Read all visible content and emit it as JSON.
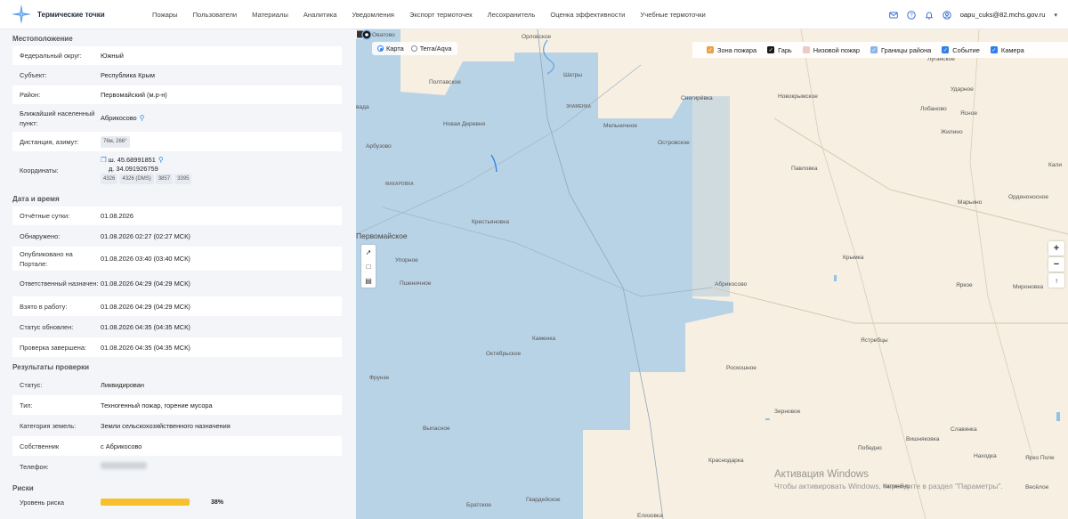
{
  "header": {
    "app_title": "Термические точки",
    "nav": [
      "Пожары",
      "Пользователи",
      "Материалы",
      "Аналитика",
      "Уведомления",
      "Экспорт термоточек",
      "Лесохранитель",
      "Оценка эффективности",
      "Учебные термоточки"
    ],
    "user_email": "oapu_cuks@82.mchs.gov.ru"
  },
  "location": {
    "title": "Местоположение",
    "rows": [
      {
        "label": "Федеральный округ:",
        "value": "Южный"
      },
      {
        "label": "Субъект:",
        "value": "Республика Крым"
      },
      {
        "label": "Район:",
        "value": "Первомайский (м.р-н)"
      },
      {
        "label": "Ближайший населенный пункт:",
        "value": "Абрикосово"
      },
      {
        "label": "Дистанция, азимут:",
        "value": "76м, 266°"
      },
      {
        "label": "Координаты:",
        "lat": "ш. 45.68991851",
        "lon": "д. 34.091926759",
        "chips": [
          "4326",
          "4326 (DMS)",
          "3857",
          "3395"
        ]
      }
    ]
  },
  "datetime": {
    "title": "Дата и время",
    "rows": [
      {
        "label": "Отчётные сутки:",
        "value": "01.08.2026"
      },
      {
        "label": "Обнаружено:",
        "value": "01.08.2026 02:27 (02:27 МСК)"
      },
      {
        "label": "Опубликовано на Портале:",
        "value": "01.08.2026 03:40 (03:40 МСК)"
      },
      {
        "label": "Ответственный назначен:",
        "value": "01.08.2026 04:29 (04:29 МСК)"
      },
      {
        "label": "Взято в работу:",
        "value": "01.08.2026 04:29 (04:29 МСК)"
      },
      {
        "label": "Статус обновлен:",
        "value": "01.08.2026 04:35 (04:35 МСК)"
      },
      {
        "label": "Проверка завершена:",
        "value": "01.08.2026 04:35 (04:35 МСК)"
      }
    ]
  },
  "results": {
    "title": "Результаты проверки",
    "rows": [
      {
        "label": "Статус:",
        "value": "Ликвидирован"
      },
      {
        "label": "Тип:",
        "value": "Техногенный пожар, горение мусора"
      },
      {
        "label": "Категория земель:",
        "value": "Земли сельскохозяйственного назначения"
      },
      {
        "label": "Собственник",
        "value": "с Абрикосово"
      },
      {
        "label": "Телефон:",
        "value": ""
      }
    ]
  },
  "risks": {
    "title": "Риски",
    "label": "Уровень риска",
    "level_percent": 38,
    "level_text": "38%",
    "bar_color": "#f7c02c"
  },
  "map": {
    "layers": [
      {
        "label": "Карта",
        "selected": true
      },
      {
        "label": "Terra/Aqva",
        "selected": false
      }
    ],
    "legend": [
      {
        "label": "Зона пожара",
        "color": "#e8a04a",
        "checked": true
      },
      {
        "label": "Гарь",
        "color": "#1a1a1a",
        "checked": true
      },
      {
        "label": "Низовой пожар",
        "color": "#f1c9c3",
        "checked": false
      },
      {
        "label": "Границы района",
        "color": "#8db4e8",
        "checked": true
      },
      {
        "label": "Событие",
        "color": "#2f80ed",
        "checked": true
      },
      {
        "label": "Камера",
        "color": "#2f80ed",
        "checked": true
      }
    ],
    "place_labels": {
      "ovatovo": "Оватово",
      "orlovskoe": "Орловское",
      "shatry": "Шатры",
      "poltavskoe": "Полтавское",
      "snegirevka": "Снегирёвка",
      "znamenka": "ЗНАМЕНКА",
      "melnichnoe": "Мельничное",
      "novaya_derevnya": "Новая Деревня",
      "novokrymskoe": "Новокрымское",
      "lugansk": "Луганское",
      "udarnoe": "Ударное",
      "lobanovo": "Лобаново",
      "yasnoe": "Ясное",
      "zhilino": "Жилино",
      "vada": "вада",
      "arbuzovo": "Арбузово",
      "ostrovskoe": "Островское",
      "pavlovka": "Павловка",
      "makarovka": "МАКАРОВКА",
      "marino": "Марьино",
      "ordenonosnoe": "Орденоносное",
      "kali": "Кали",
      "krestyanovka": "Крестьяновка",
      "pervomaiskoe": "Первомайское",
      "upornoe": "Упорное",
      "krymka": "Крымка",
      "pshenichnoe": "Пшеничное",
      "abrikosovo": "Абрикосово",
      "yarkoe": "Яркое",
      "mironovka": "Миронов­ка",
      "kamenka": "Каменка",
      "oktyabrskoe": "Октябрьское",
      "yastrebtsy": "Ястребцы",
      "roskoshnoe": "Роскошное",
      "frunze": "Фрунзе",
      "zernovoe": "Зерновое",
      "vypasnoe": "Выпасное",
      "slavyanka": "Славянка",
      "vishnyakovka": "Вишняковка",
      "pobednoe": "Победно",
      "nakhodka": "Находка",
      "krasnodarka": "Краснодарка",
      "yarkoe_pole": "Ярко Поле",
      "kalinino": "Калинино",
      "veseloe": "Весёлое",
      "bratskoe": "Братское",
      "gvardeyskoe": "Гвардейское",
      "elizhovka": "Елизовка"
    }
  },
  "watermark": {
    "line1": "Активация Windows",
    "line2": "Чтобы активировать Windows, перейдите в раздел \"Параметры\"."
  }
}
